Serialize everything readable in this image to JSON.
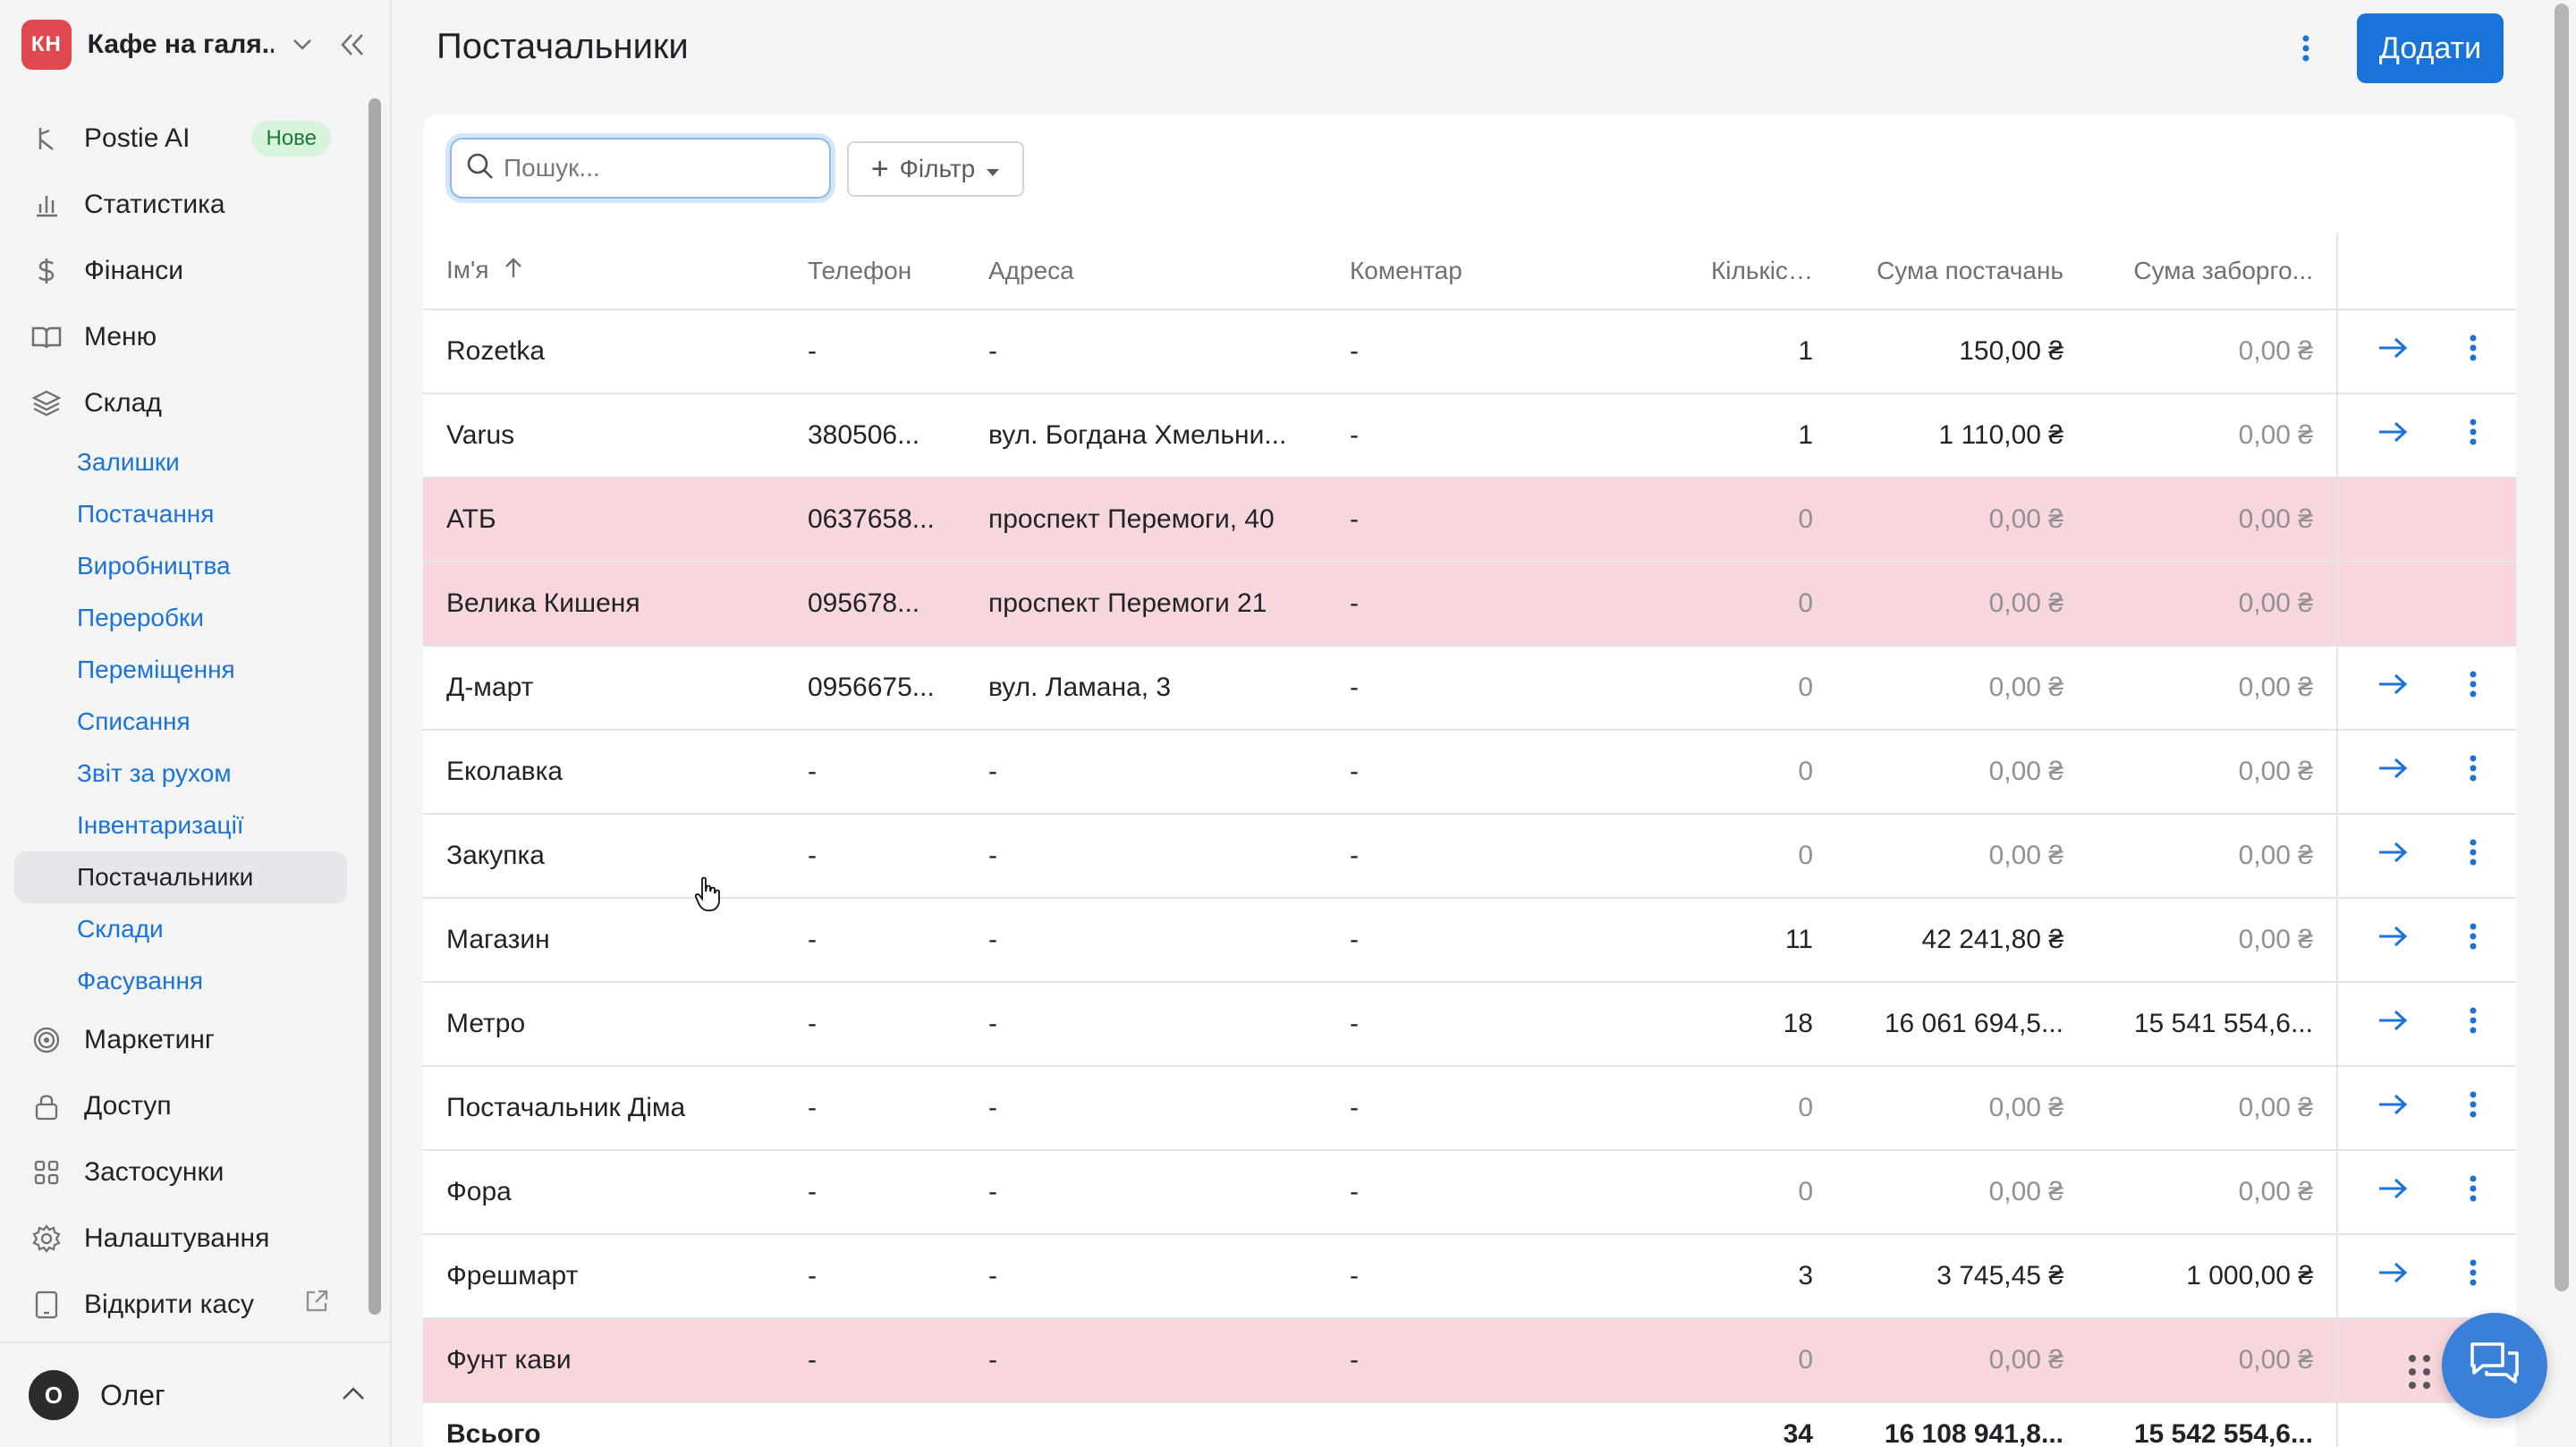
{
  "sidebar": {
    "logo_initials": "КН",
    "company": "Кафе на галя...",
    "nav_top": [
      {
        "label": "Postie AI",
        "badge": "Нове",
        "icon": "ai-icon"
      },
      {
        "label": "Статистика",
        "icon": "bar-chart-icon"
      },
      {
        "label": "Фінанси",
        "icon": "dollar-icon"
      },
      {
        "label": "Меню",
        "icon": "book-icon"
      },
      {
        "label": "Склад",
        "icon": "layers-icon"
      }
    ],
    "sub_items": [
      "Залишки",
      "Постачання",
      "Виробництва",
      "Переробки",
      "Переміщення",
      "Списання",
      "Звіт за рухом",
      "Інвентаризації",
      "Постачальники",
      "Склади",
      "Фасування"
    ],
    "active_sub": "Постачальники",
    "nav_bottom": [
      {
        "label": "Маркетинг",
        "icon": "target-icon"
      },
      {
        "label": "Доступ",
        "icon": "lock-icon"
      },
      {
        "label": "Застосунки",
        "icon": "grid-icon"
      },
      {
        "label": "Налаштування",
        "icon": "gear-icon"
      },
      {
        "label": "Відкрити касу",
        "icon": "tablet-icon"
      }
    ],
    "user": {
      "initial": "О",
      "name": "Олег"
    }
  },
  "header": {
    "title": "Постачальники",
    "add_label": "Додати"
  },
  "toolbar": {
    "search_placeholder": "Пошук...",
    "filter_label": "Фільтр"
  },
  "table": {
    "columns": [
      "Ім'я",
      "Телефон",
      "Адреса",
      "Коментар",
      "Кількіст...",
      "Сума постачань",
      "Сума заборго..."
    ],
    "rows": [
      {
        "name": "Rozetka",
        "phone": "-",
        "address": "-",
        "comment": "-",
        "count": "1",
        "sum": "150,00 ₴",
        "debt": "0,00 ₴",
        "highlight": false,
        "actions": true
      },
      {
        "name": "Varus",
        "phone": "380506...",
        "address": "вул. Богдана Хмельни...",
        "comment": "-",
        "count": "1",
        "sum": "1 110,00 ₴",
        "debt": "0,00 ₴",
        "highlight": false,
        "actions": true
      },
      {
        "name": "АТБ",
        "phone": "0637658...",
        "address": "проспект Перемоги, 40",
        "comment": "-",
        "count": "0",
        "sum": "0,00 ₴",
        "debt": "0,00 ₴",
        "highlight": true,
        "actions": false
      },
      {
        "name": "Велика Кишеня",
        "phone": "095678...",
        "address": "проспект Перемоги 21",
        "comment": "-",
        "count": "0",
        "sum": "0,00 ₴",
        "debt": "0,00 ₴",
        "highlight": true,
        "actions": false
      },
      {
        "name": "Д-март",
        "phone": "0956675...",
        "address": "вул. Ламана, 3",
        "comment": "-",
        "count": "0",
        "sum": "0,00 ₴",
        "debt": "0,00 ₴",
        "highlight": false,
        "actions": true
      },
      {
        "name": "Еколавка",
        "phone": "-",
        "address": "-",
        "comment": "-",
        "count": "0",
        "sum": "0,00 ₴",
        "debt": "0,00 ₴",
        "highlight": false,
        "actions": true
      },
      {
        "name": "Закупка",
        "phone": "-",
        "address": "-",
        "comment": "-",
        "count": "0",
        "sum": "0,00 ₴",
        "debt": "0,00 ₴",
        "highlight": false,
        "actions": true
      },
      {
        "name": "Магазин",
        "phone": "-",
        "address": "-",
        "comment": "-",
        "count": "11",
        "sum": "42 241,80 ₴",
        "debt": "0,00 ₴",
        "highlight": false,
        "actions": true
      },
      {
        "name": "Метро",
        "phone": "-",
        "address": "-",
        "comment": "-",
        "count": "18",
        "sum": "16 061 694,5...",
        "debt": "15 541 554,6...",
        "highlight": false,
        "actions": true
      },
      {
        "name": "Постачальник Діма",
        "phone": "-",
        "address": "-",
        "comment": "-",
        "count": "0",
        "sum": "0,00 ₴",
        "debt": "0,00 ₴",
        "highlight": false,
        "actions": true
      },
      {
        "name": "Фора",
        "phone": "-",
        "address": "-",
        "comment": "-",
        "count": "0",
        "sum": "0,00 ₴",
        "debt": "0,00 ₴",
        "highlight": false,
        "actions": true
      },
      {
        "name": "Фрешмарт",
        "phone": "-",
        "address": "-",
        "comment": "-",
        "count": "3",
        "sum": "3 745,45 ₴",
        "debt": "1 000,00 ₴",
        "highlight": false,
        "actions": true
      },
      {
        "name": "Фунт кави",
        "phone": "-",
        "address": "-",
        "comment": "-",
        "count": "0",
        "sum": "0,00 ₴",
        "debt": "0,00 ₴",
        "highlight": true,
        "actions": false
      }
    ],
    "total": {
      "label": "Всього",
      "count": "34",
      "sum": "16 108 941,8...",
      "debt": "15 542 554,6..."
    }
  },
  "colors": {
    "accent": "#1a73d9",
    "highlight_row": "#f8d7dc",
    "logo": "#e0484f"
  }
}
